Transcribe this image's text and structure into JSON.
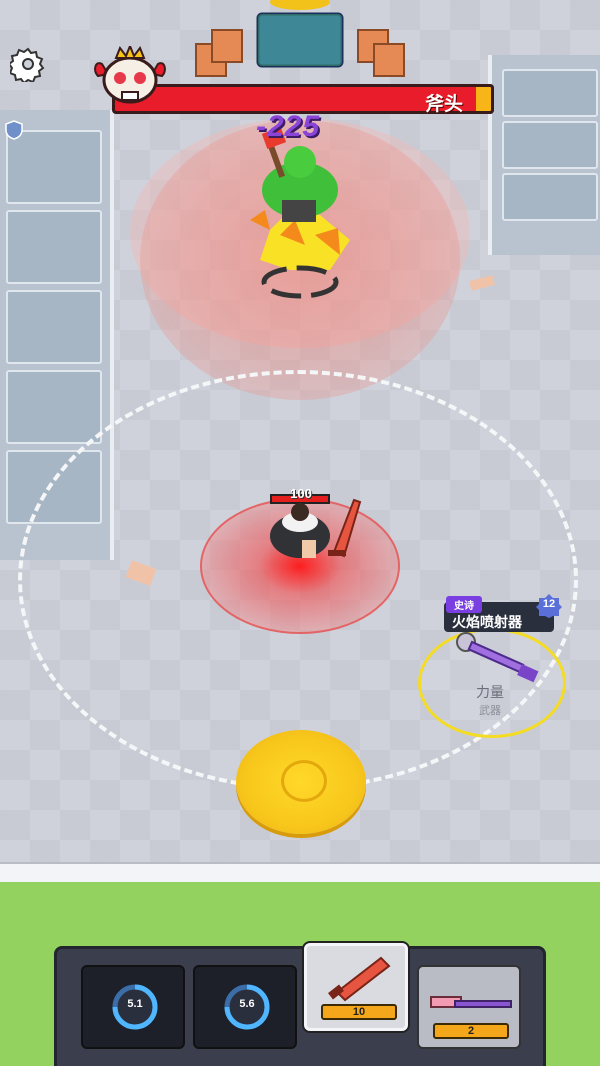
{
  "boss": {
    "name": "斧头",
    "damage_popup": "-225"
  },
  "player": {
    "hp": "100"
  },
  "weapon_drop": {
    "rarity": "史诗",
    "name": "火焰喷射器",
    "level": "12",
    "stat_label": "力量",
    "stat_sub": "武器"
  },
  "hotbar": {
    "slots": [
      {
        "type": "skill",
        "cooldown": "5.1"
      },
      {
        "type": "skill",
        "cooldown": "5.6"
      },
      {
        "type": "weapon",
        "icon": "sword-icon",
        "ammo": "10",
        "selected": true
      },
      {
        "type": "weapon",
        "icon": "rifle-icon",
        "ammo": "2",
        "selected": false
      }
    ]
  },
  "colors": {
    "boss_bar": "#e81c2a",
    "epic": "#7a3fe0",
    "coin": "#f8c71c",
    "player_zone": "#ff1414"
  }
}
